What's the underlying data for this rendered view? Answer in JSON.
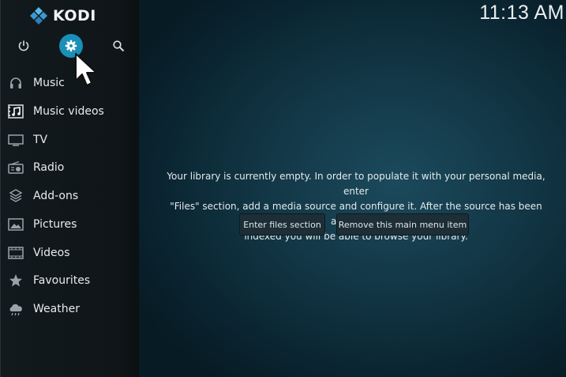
{
  "app": {
    "name": "KODI"
  },
  "clock": {
    "time": "11:13 AM"
  },
  "topbar": {
    "power": "power-icon",
    "settings": "gear-icon",
    "search": "search-icon"
  },
  "menu": {
    "items": [
      {
        "label": "Music",
        "icon": "headphones-icon"
      },
      {
        "label": "Music videos",
        "icon": "music-video-icon"
      },
      {
        "label": "TV",
        "icon": "tv-icon"
      },
      {
        "label": "Radio",
        "icon": "radio-icon"
      },
      {
        "label": "Add-ons",
        "icon": "addons-box-icon"
      },
      {
        "label": "Pictures",
        "icon": "picture-icon"
      },
      {
        "label": "Videos",
        "icon": "film-strip-icon"
      },
      {
        "label": "Favourites",
        "icon": "star-icon"
      },
      {
        "label": "Weather",
        "icon": "cloud-icon"
      }
    ]
  },
  "content": {
    "message_line1": "Your library is currently empty. In order to populate it with your personal media, enter",
    "message_line2": "\"Files\" section, add a media source and configure it. After the source has been added and",
    "message_line3": "indexed you will be able to browse your library.",
    "enter_files_label": "Enter files section",
    "remove_item_label": "Remove this main menu item"
  },
  "colors": {
    "accent": "#1a8fb8",
    "sidebar": "#121a1e",
    "background": "#123645"
  }
}
